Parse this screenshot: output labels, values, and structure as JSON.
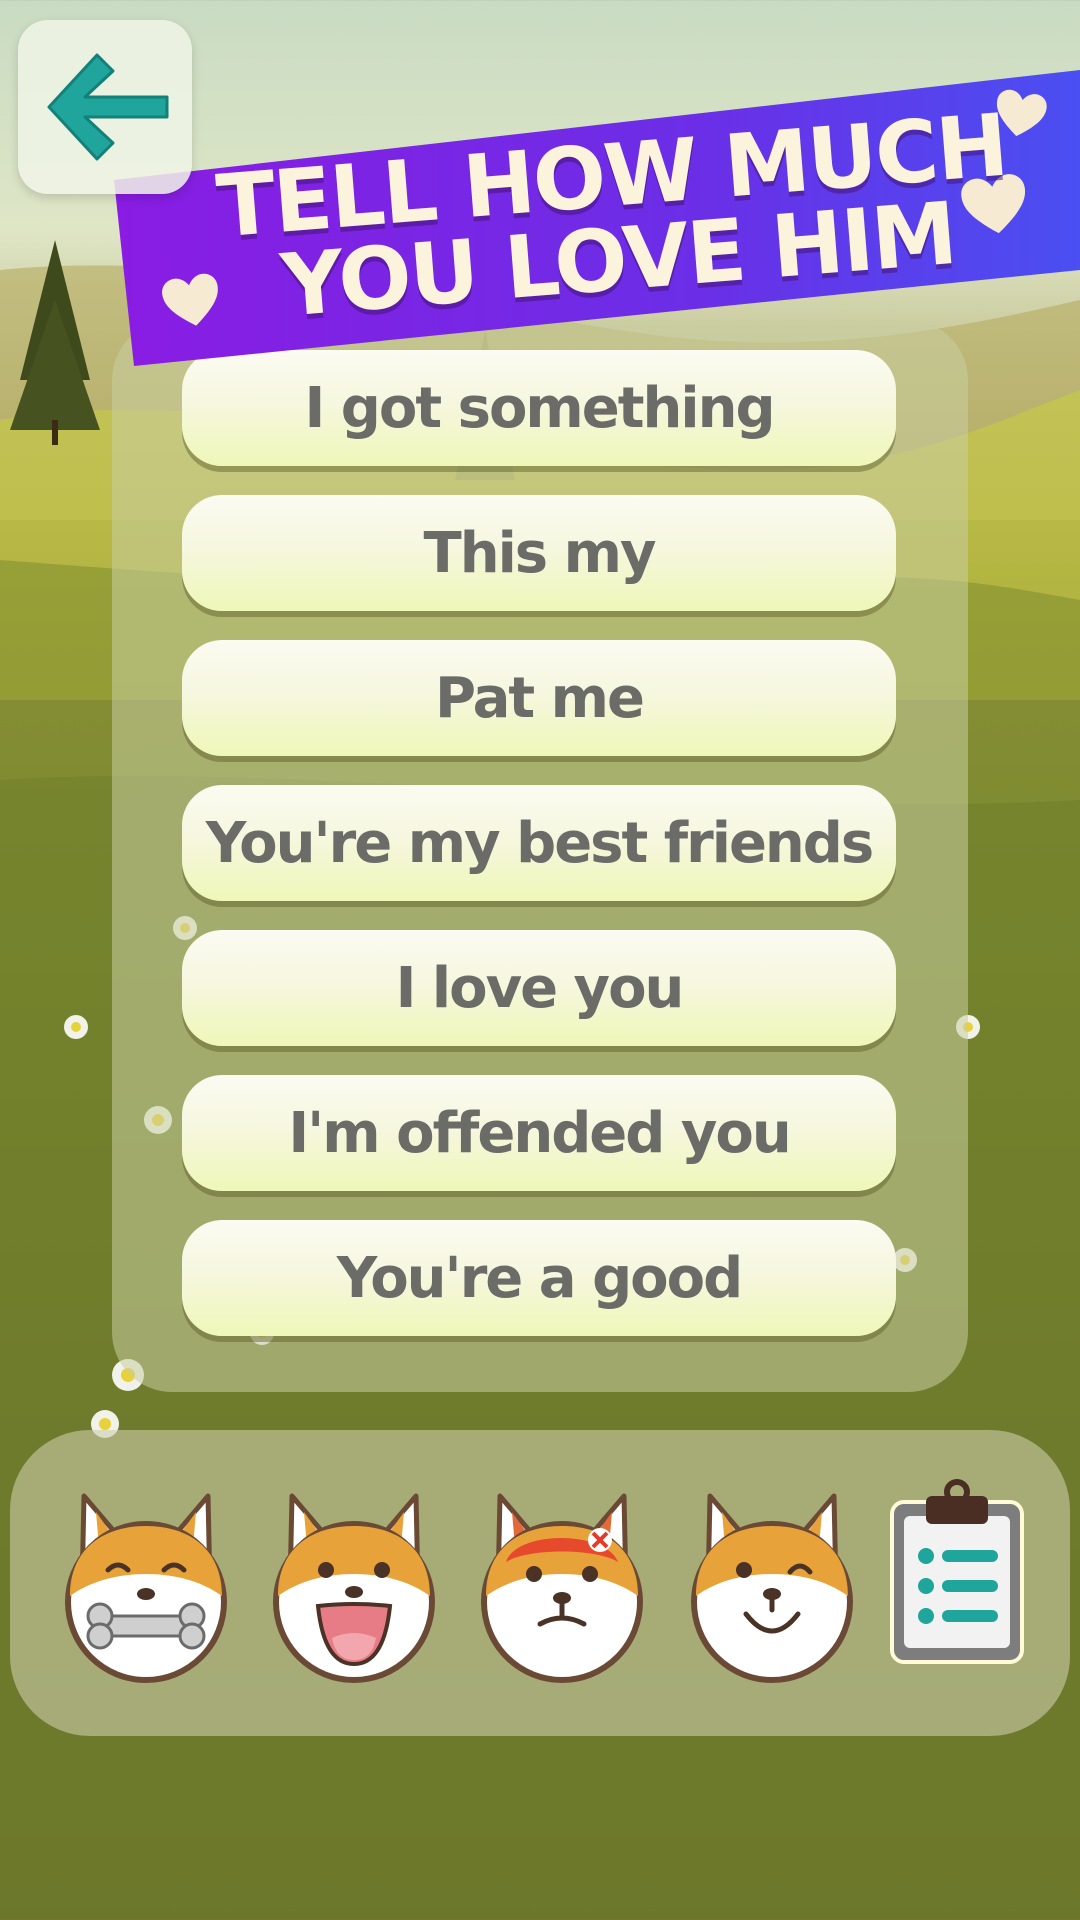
{
  "header": {
    "back_icon": "arrow-left-icon",
    "title_line1": "TELL HOW MUCH",
    "title_line2": "YOU LOVE HIM"
  },
  "phrases": [
    {
      "label": "I got something"
    },
    {
      "label": "This my"
    },
    {
      "label": "Pat me"
    },
    {
      "label": "You're my best friends"
    },
    {
      "label": "I love you"
    },
    {
      "label": "I'm offended you"
    },
    {
      "label": "You're a good"
    }
  ],
  "emoji_bar": {
    "items": [
      {
        "icon": "dog-bone-emoji-icon"
      },
      {
        "icon": "dog-happy-emoji-icon"
      },
      {
        "icon": "dog-angry-emoji-icon"
      },
      {
        "icon": "dog-wink-emoji-icon"
      },
      {
        "icon": "clipboard-list-icon"
      }
    ]
  },
  "colors": {
    "banner": "#7b1ee0",
    "back_arrow": "#1fa59b",
    "button_text": "#6b6b68",
    "dog_orange": "#e8a23a"
  }
}
